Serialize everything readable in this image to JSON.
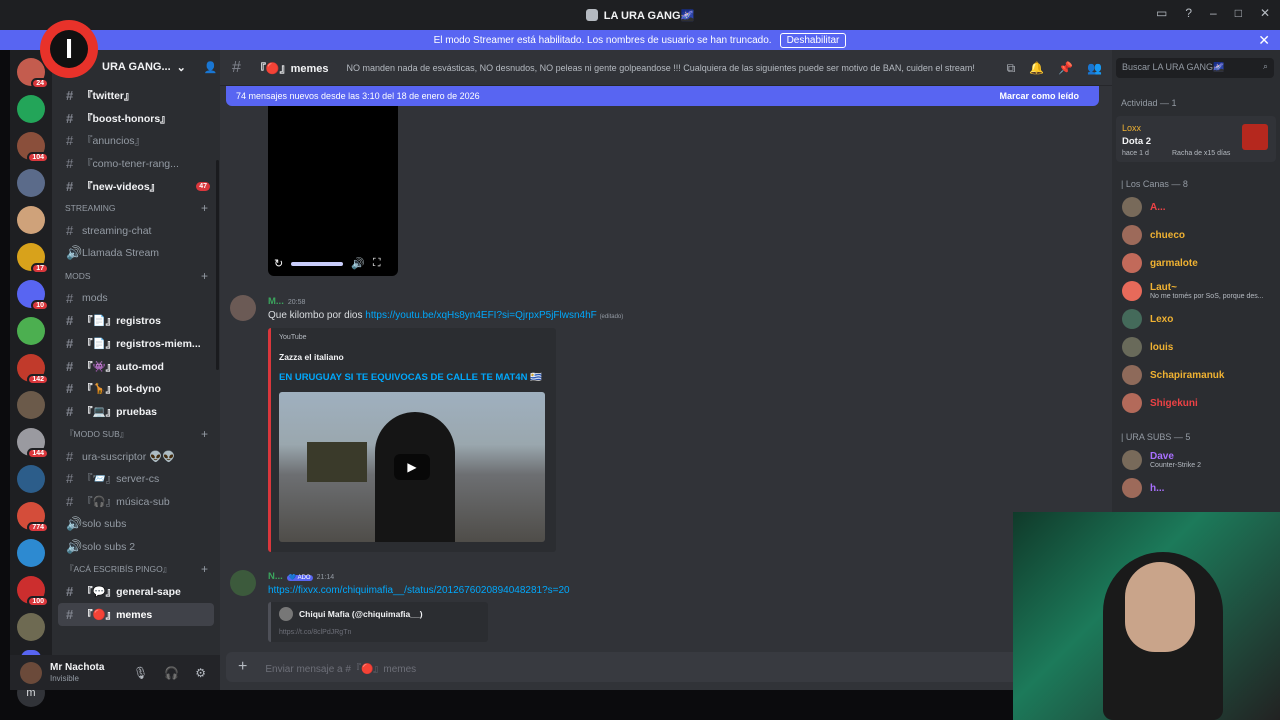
{
  "window": {
    "title": "LA URA GANG🌌"
  },
  "banner": {
    "text": "El modo Streamer está habilitado. Los nombres de usuario se han truncado.",
    "button": "Deshabilitar"
  },
  "rail": {
    "icons": [
      {
        "color": "#c45c4e",
        "badge": "24"
      },
      {
        "color": "#23a559",
        "badge": ""
      },
      {
        "color": "#8a4f3b",
        "badge": "104"
      },
      {
        "color": "#5b6b8a",
        "badge": ""
      },
      {
        "color": "#cfa27a",
        "badge": ""
      },
      {
        "color": "#d8a21b",
        "badge": "17"
      },
      {
        "color": "#5865f2",
        "badge": "10"
      },
      {
        "color": "#4caf50",
        "badge": ""
      },
      {
        "color": "#c13a2b",
        "badge": "142"
      },
      {
        "color": "#6b5a4a",
        "badge": ""
      },
      {
        "color": "#9a9aa0",
        "badge": "144"
      },
      {
        "color": "#2c5d8a",
        "badge": ""
      },
      {
        "color": "#d44d3a",
        "badge": "774"
      },
      {
        "color": "#2d8ad1",
        "badge": ""
      },
      {
        "color": "#cc2e2e",
        "badge": "100"
      },
      {
        "color": "#6e6a52",
        "badge": ""
      }
    ],
    "dm_letter": "m"
  },
  "sidebar": {
    "server_name": "URA GANG...",
    "logo_letter": "I",
    "channels": [
      {
        "label": "『twitter』",
        "unread": true,
        "badge": ""
      },
      {
        "label": "『boost-honors』",
        "unread": true,
        "badge": ""
      },
      {
        "label": "『anuncios』",
        "unread": false,
        "badge": ""
      },
      {
        "label": "『como-tener-rang...",
        "unread": false,
        "badge": ""
      },
      {
        "label": "『new-videos』",
        "unread": true,
        "badge": "47"
      }
    ],
    "cat_streaming": "STREAMING",
    "streaming": [
      {
        "label": "streaming-chat"
      },
      {
        "label": "Llamada Stream"
      }
    ],
    "cat_mods": "mods",
    "mods": [
      {
        "label": "mods",
        "unread": false
      },
      {
        "label": "『📄』registros",
        "unread": true
      },
      {
        "label": "『📄』registros-miem...",
        "unread": true
      },
      {
        "label": "『👾』auto-mod",
        "unread": true
      },
      {
        "label": "『🦒』bot-dyno",
        "unread": true
      },
      {
        "label": "『💻』pruebas",
        "unread": true
      }
    ],
    "cat_modosub": "『MODO SUB』",
    "modosub": [
      {
        "label": "ura-suscriptor 👽👽"
      },
      {
        "label": "『📨』server-cs"
      },
      {
        "label": "『🎧』música-sub"
      },
      {
        "label": "solo subs"
      },
      {
        "label": "solo subs 2"
      }
    ],
    "cat_pingo": "『acá escribís pingo』",
    "pingo": [
      {
        "label": "『💬』general-sape",
        "unread": true
      },
      {
        "label": "『🔴』memes",
        "unread": true
      }
    ]
  },
  "user": {
    "name": "Mr Nachota",
    "status": "Invisible"
  },
  "channel": {
    "name": "『🔴』memes",
    "topic": "NO manden nada de esvásticas, NO desnudos, NO peleas ni gente golpeandose !!! Cualquiera de las siguientes puede ser motivo de BAN, cuiden el stream!"
  },
  "newbar": {
    "text": "74 mensajes nuevos desde las 3:10 del 18 de enero de 2026",
    "mark": "Marcar como leído"
  },
  "messages": [
    {
      "author": "M...",
      "time": "20:58",
      "text": "Que kilombo por dios ",
      "link": "https://youtu.be/xqHs8yn4EFI?si=QjrpxP5jFlwsn4hF",
      "edited": "(editado)",
      "embed": {
        "provider": "YouTube",
        "author": "Zazza el italiano",
        "title": "EN URUGUAY SI TE EQUIVOCAS DE CALLE TE MAT4N 🇺🇾"
      }
    },
    {
      "author": "N...",
      "tag": "💙 ADO",
      "time": "21:14",
      "link": "https://fixvx.com/chiquimafia__/status/2012676020894048281?s=20",
      "embed": {
        "author": "Chiqui Mafia (@chiquimafia__)",
        "sub": "https://t.co/8clPdJRgTn"
      }
    }
  ],
  "composer": {
    "placeholder": "Enviar mensaje a #『🔴』memes"
  },
  "members": {
    "search": "Buscar LA URA GANG🌌",
    "activity_header": "Actividad — 1",
    "activity": {
      "user": "Loxx",
      "game": "Dota 2",
      "time": "hace 1 d",
      "streak": "Racha de x15 días"
    },
    "group1": "| Los Canas — 8",
    "list1": [
      {
        "name": "A...",
        "color": "#ed4245",
        "status": ""
      },
      {
        "name": "chueco",
        "color": "#f0b232",
        "status": ""
      },
      {
        "name": "garmalote",
        "color": "#f0b232",
        "status": ""
      },
      {
        "name": "Laut~",
        "color": "#f0b232",
        "status": "No me tomés por SoS, porque des..."
      },
      {
        "name": "Lexo",
        "color": "#f0b232",
        "status": ""
      },
      {
        "name": "louis",
        "color": "#f0b232",
        "status": ""
      },
      {
        "name": "Schapiramanuk",
        "color": "#f0b232",
        "status": ""
      },
      {
        "name": "Shigekuni",
        "color": "#ed4245",
        "status": ""
      }
    ],
    "group2": "| URA SUBS — 5",
    "list2": [
      {
        "name": "Dave",
        "color": "#a970ff",
        "status": "Counter-Strike 2"
      },
      {
        "name": "h...",
        "color": "#a970ff",
        "status": ""
      }
    ]
  }
}
